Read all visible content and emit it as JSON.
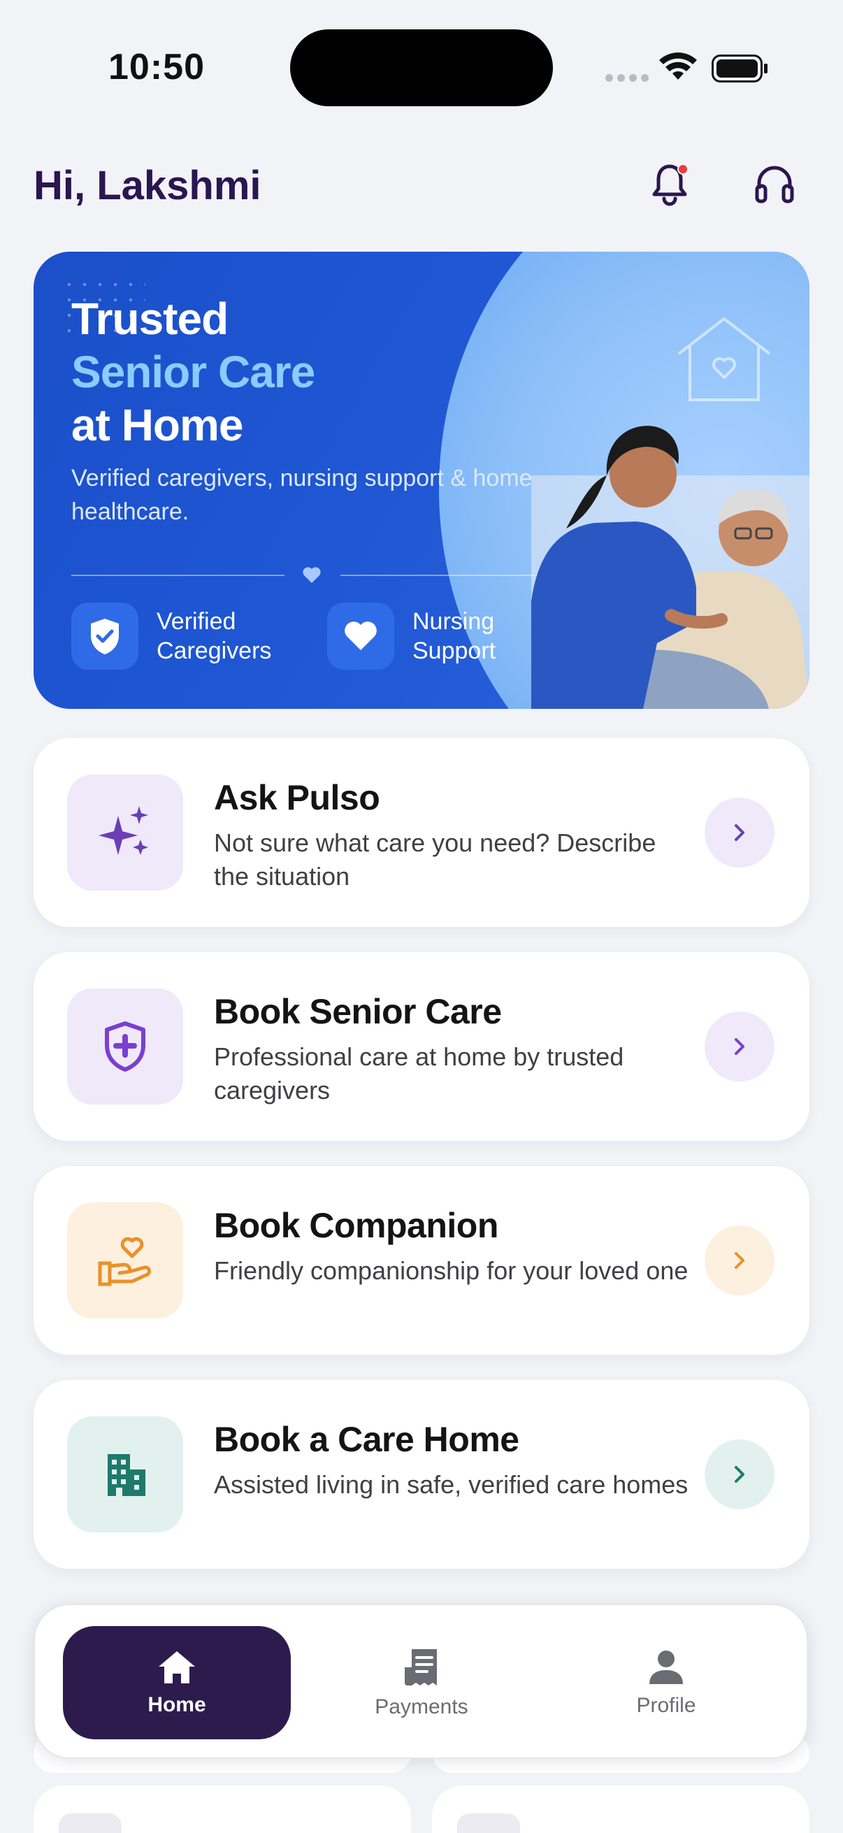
{
  "status_bar": {
    "time": "10:50"
  },
  "header": {
    "greeting": "Hi, Lakshmi"
  },
  "hero": {
    "title_line1": "Trusted",
    "title_line2": "Senior Care",
    "title_line3": "at Home",
    "subtitle": "Verified caregivers, nursing support & home healthcare.",
    "badges": [
      {
        "label": "Verified Caregivers",
        "icon": "shield-check-icon"
      },
      {
        "label": "Nursing Support",
        "icon": "heart-icon"
      }
    ]
  },
  "services": [
    {
      "title": "Ask Pulso",
      "description": "Not sure what care you need? Describe the situation",
      "icon": "sparkles-icon",
      "accent": "#6a3fb5",
      "tint": "#efe9fa"
    },
    {
      "title": "Book Senior Care",
      "description": "Professional care at home by trusted caregivers",
      "icon": "shield-plus-icon",
      "accent": "#7a3fd0",
      "tint": "#efe9fa"
    },
    {
      "title": "Book Companion",
      "description": "Friendly companionship for your loved one",
      "icon": "hand-heart-icon",
      "accent": "#e8922a",
      "tint": "#fdf0de"
    },
    {
      "title": "Book a Care Home",
      "description": "Assisted living in safe, verified care homes",
      "icon": "building-icon",
      "accent": "#1f7a6b",
      "tint": "#e3f1ee"
    }
  ],
  "nav": {
    "items": [
      {
        "label": "Home",
        "icon": "home-icon",
        "active": true
      },
      {
        "label": "Payments",
        "icon": "receipt-icon",
        "active": false
      },
      {
        "label": "Profile",
        "icon": "person-icon",
        "active": false
      }
    ]
  },
  "colors": {
    "brand_dark": "#2d1b4e",
    "hero_blue": "#1f57d4"
  }
}
